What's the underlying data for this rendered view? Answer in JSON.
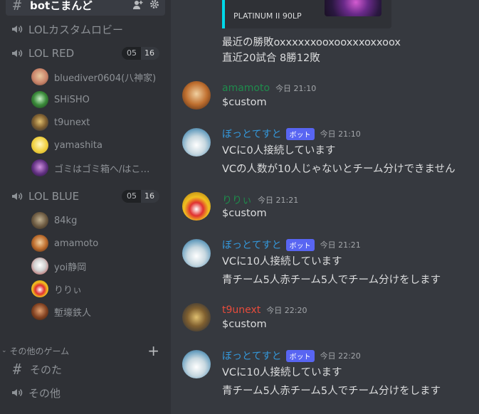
{
  "sidebar": {
    "active_channel": "botこまんど",
    "channels": [
      {
        "name": "LOLカスタムロビー"
      },
      {
        "name": "LOL RED",
        "badge_left": "05",
        "badge_right": "16"
      },
      {
        "name": "LOL BLUE",
        "badge_left": "05",
        "badge_right": "16"
      }
    ],
    "red_users": [
      "bluediver0604(八神家)",
      "SHiSHO",
      "t9unext",
      "yamashita",
      "ゴミはゴミ箱へ/はこ…"
    ],
    "blue_users": [
      "84kg",
      "amamoto",
      "yoi静岡",
      "りりぃ",
      "塹壕鉄人"
    ],
    "category": "その他のゲーム",
    "other_channels": [
      "そのた",
      "その他"
    ]
  },
  "chat": {
    "embed_text": "PLATINUM II 90LP",
    "top_lines": [
      "最近の勝敗oxxxxxxooxooxxxoxxoox",
      "直近20試合 8勝12敗"
    ],
    "bot_tag": "ボット",
    "messages": [
      {
        "author": "amamoto",
        "time": "今日 21:10",
        "lines": [
          "$custom"
        ]
      },
      {
        "author": "ぼっとてすと",
        "time": "今日 21:10",
        "lines": [
          "VCに0人接続しています",
          "VCの人数が10人じゃないとチーム分けできません"
        ]
      },
      {
        "author": "りりぃ",
        "time": "今日 21:21",
        "lines": [
          "$custom"
        ]
      },
      {
        "author": "ぼっとてすと",
        "time": "今日 21:21",
        "lines": [
          "VCに10人接続しています",
          "青チーム5人赤チーム5人でチーム分けをします"
        ]
      },
      {
        "author": "t9unext",
        "time": "今日 22:20",
        "lines": [
          "$custom"
        ]
      },
      {
        "author": "ぼっとてすと",
        "time": "今日 22:20",
        "lines": [
          "VCに10人接続しています",
          "青チーム5人赤チーム5人でチーム分けをします"
        ]
      }
    ]
  },
  "colors": {
    "background": "#36393f",
    "sidebar": "#2f3136",
    "embed_border": "#00d9e9",
    "bot_badge": "#5865f2",
    "name_green": "#1f8b4c",
    "name_blue": "#3498db",
    "name_red": "#e74c3c"
  }
}
